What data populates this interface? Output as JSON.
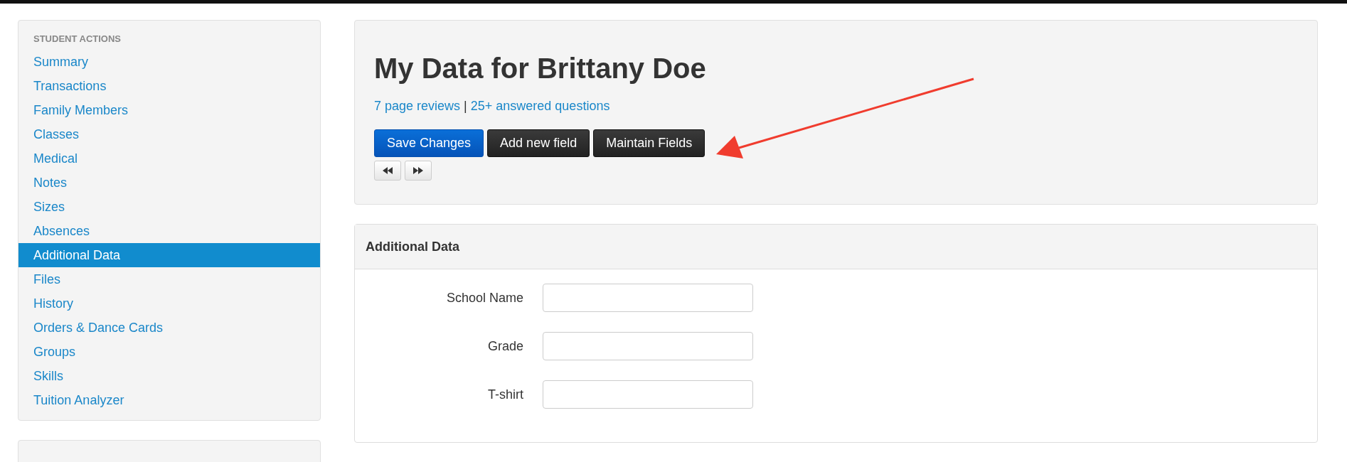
{
  "sidebar": {
    "heading": "STUDENT ACTIONS",
    "items": [
      {
        "label": "Summary",
        "selected": false
      },
      {
        "label": "Transactions",
        "selected": false
      },
      {
        "label": "Family Members",
        "selected": false
      },
      {
        "label": "Classes",
        "selected": false
      },
      {
        "label": "Medical",
        "selected": false
      },
      {
        "label": "Notes",
        "selected": false
      },
      {
        "label": "Sizes",
        "selected": false
      },
      {
        "label": "Absences",
        "selected": false
      },
      {
        "label": "Additional Data",
        "selected": true
      },
      {
        "label": "Files",
        "selected": false
      },
      {
        "label": "History",
        "selected": false
      },
      {
        "label": "Orders & Dance Cards",
        "selected": false
      },
      {
        "label": "Groups",
        "selected": false
      },
      {
        "label": "Skills",
        "selected": false
      },
      {
        "label": "Tuition Analyzer",
        "selected": false
      }
    ]
  },
  "header": {
    "title": "My Data for Brittany Doe",
    "links": [
      "7 page reviews",
      "25+ answered questions"
    ],
    "separator": "|",
    "buttons": [
      {
        "label": "Save Changes",
        "kind": "primary"
      },
      {
        "label": "Add new field",
        "kind": "dark"
      },
      {
        "label": "Maintain Fields",
        "kind": "dark"
      }
    ],
    "nav_buttons": [
      {
        "kind": "back"
      },
      {
        "kind": "forward"
      }
    ]
  },
  "panel": {
    "title": "Additional Data",
    "fields": [
      {
        "label": "School Name"
      },
      {
        "label": "Grade"
      },
      {
        "label": "T-shirt"
      }
    ]
  }
}
